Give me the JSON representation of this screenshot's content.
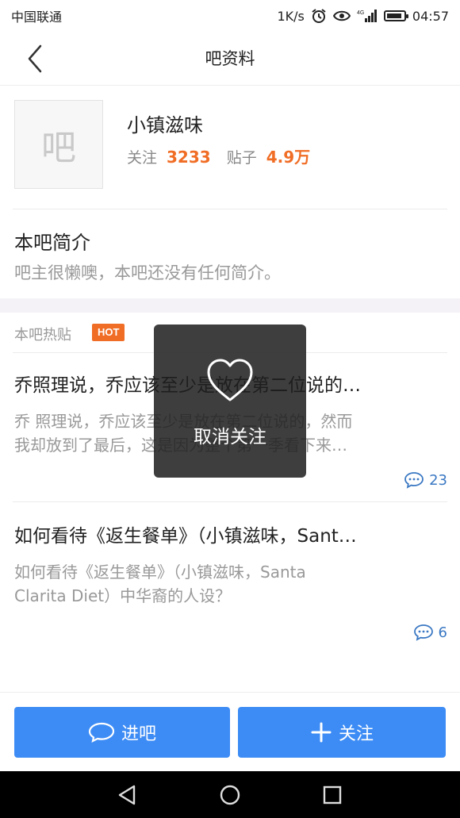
{
  "status_bar": {
    "carrier": "中国联通",
    "speed": "1K/s",
    "network": "4G",
    "time": "04:57"
  },
  "nav": {
    "title": "吧资料",
    "back_icon": "chevron-left-icon"
  },
  "forum": {
    "avatar_text": "吧",
    "name": "小镇滋味",
    "followers_label": "关注",
    "followers": "3233",
    "posts_label": "贴子",
    "posts": "4.9万"
  },
  "intro": {
    "title": "本吧简介",
    "text": "吧主很懒噢，本吧还没有任何简介。"
  },
  "hot": {
    "label": "本吧热贴",
    "badge": "HOT",
    "posts": [
      {
        "title": "乔照理说，乔应该至少是放在第二位说的…",
        "body_line1": "乔 照理说，乔应该至少是放在第二位说的，然而",
        "body_line2": "我却放到了最后，这是因为整个第一季看下来…",
        "comments": "23"
      },
      {
        "title": "如何看待《返生餐单》（小镇滋味，Sant…",
        "body_line1": "如何看待《返生餐单》（小镇滋味，Santa",
        "body_line2": "Clarita Diet）中华裔的人设？",
        "comments": "6"
      }
    ]
  },
  "actions": {
    "enter": "进吧",
    "follow": "关注"
  },
  "toast": {
    "text": "取消关注",
    "icon": "heart-outline-icon"
  },
  "colors": {
    "accent_blue": "#3d8cf5",
    "accent_orange": "#f06d25",
    "comment_blue": "#3a78c3"
  }
}
